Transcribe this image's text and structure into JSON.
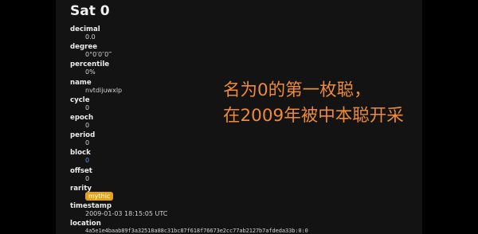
{
  "sat": {
    "title": "Sat 0",
    "fields": {
      "decimal": {
        "label": "decimal",
        "value": "0.0"
      },
      "degree": {
        "label": "degree",
        "value": "0°0′0″0‴"
      },
      "percentile": {
        "label": "percentile",
        "value": "0%"
      },
      "name": {
        "label": "name",
        "value": "nvtdijuwxlp"
      },
      "cycle": {
        "label": "cycle",
        "value": "0"
      },
      "epoch": {
        "label": "epoch",
        "value": "0"
      },
      "period": {
        "label": "period",
        "value": "0"
      },
      "block": {
        "label": "block",
        "value": "0"
      },
      "offset": {
        "label": "offset",
        "value": "0"
      },
      "rarity": {
        "label": "rarity",
        "value": "mythic"
      },
      "timestamp": {
        "label": "timestamp",
        "value": "2009-01-03 18:15:05 UTC"
      },
      "location": {
        "label": "location",
        "value": "4a5e1e4baab89f3a32518a88c31bc87f618f76673e2cc77ab2127b7afdeda33b:0:0"
      }
    }
  },
  "caption": {
    "line1": "名为0的第一枚聪，",
    "line2": "在2009年被中本聪开采"
  },
  "colors": {
    "background": "#000000",
    "panel": "#131313",
    "caption": "#ec8a3e",
    "badge": "#e2a21a",
    "link": "#5b8fe6"
  }
}
